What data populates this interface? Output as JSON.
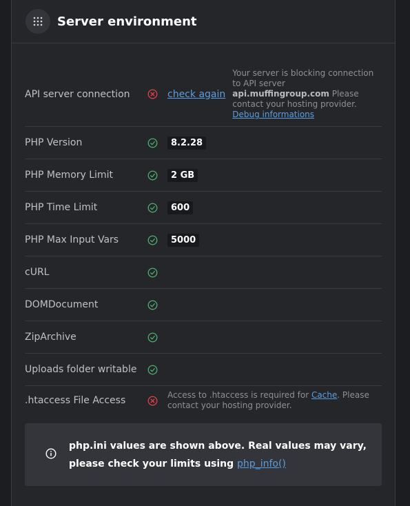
{
  "header": {
    "title": "Server environment",
    "menu_icon": "grid-dots-icon"
  },
  "colors": {
    "ok": "#4caf72",
    "error": "#e0434b",
    "link": "#5b9ee0"
  },
  "rows": [
    {
      "label": "API server connection",
      "status": "error",
      "check_link": "check again",
      "note_prefix": "Your server is blocking connection to API server ",
      "note_host": "api.muffingroup.com",
      "note_suffix": " Please contact your hosting provider.",
      "debug_link": "Debug informations"
    },
    {
      "label": "PHP Version",
      "status": "ok",
      "value": "8.2.28"
    },
    {
      "label": "PHP Memory Limit",
      "status": "ok",
      "value": "2 GB"
    },
    {
      "label": "PHP Time Limit",
      "status": "ok",
      "value": "600"
    },
    {
      "label": "PHP Max Input Vars",
      "status": "ok",
      "value": "5000"
    },
    {
      "label": "cURL",
      "status": "ok"
    },
    {
      "label": "DOMDocument",
      "status": "ok"
    },
    {
      "label": "ZipArchive",
      "status": "ok"
    },
    {
      "label": "Uploads folder writable",
      "status": "ok"
    },
    {
      "label": ".htaccess File Access",
      "status": "error",
      "note_prefix": "Access to .htaccess is required for ",
      "note_link": "Cache",
      "note_suffix": ". Please contact your hosting provider."
    }
  ],
  "info": {
    "text": "php.ini values are shown above. Real values may vary, please check your limits using ",
    "link": "php_info()"
  }
}
